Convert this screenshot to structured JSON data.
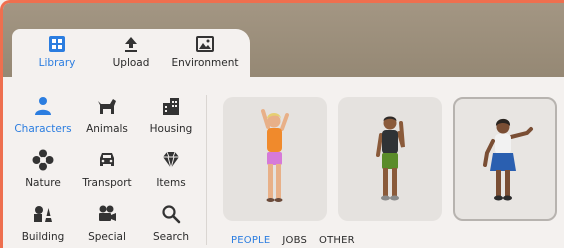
{
  "colors": {
    "accent": "#2b7de0",
    "frame": "#ee6f4f",
    "header": "#9e917d"
  },
  "tabs": [
    {
      "label": "Library",
      "icon": "library-icon",
      "active": true
    },
    {
      "label": "Upload",
      "icon": "upload-icon",
      "active": false
    },
    {
      "label": "Environment",
      "icon": "environment-icon",
      "active": false
    }
  ],
  "categories": [
    {
      "label": "Characters",
      "icon": "person-icon",
      "active": true
    },
    {
      "label": "Animals",
      "icon": "dog-icon",
      "active": false
    },
    {
      "label": "Housing",
      "icon": "building-icon",
      "active": false
    },
    {
      "label": "Nature",
      "icon": "flower-icon",
      "active": false
    },
    {
      "label": "Transport",
      "icon": "car-icon",
      "active": false
    },
    {
      "label": "Items",
      "icon": "diamond-icon",
      "active": false
    },
    {
      "label": "Building",
      "icon": "shapes-icon",
      "active": false
    },
    {
      "label": "Special",
      "icon": "camera-icon",
      "active": false
    },
    {
      "label": "Search",
      "icon": "search-icon",
      "active": false
    }
  ],
  "characters": [
    {
      "icon": "character-blonde-orange-shirt-icon",
      "selected": false
    },
    {
      "icon": "character-dark-shirt-green-shorts-icon",
      "selected": false
    },
    {
      "icon": "character-white-shirt-blue-skirt-icon",
      "selected": true
    }
  ],
  "subtabs": [
    {
      "label": "PEOPLE",
      "active": true
    },
    {
      "label": "JOBS",
      "active": false
    },
    {
      "label": "OTHER",
      "active": false
    }
  ]
}
